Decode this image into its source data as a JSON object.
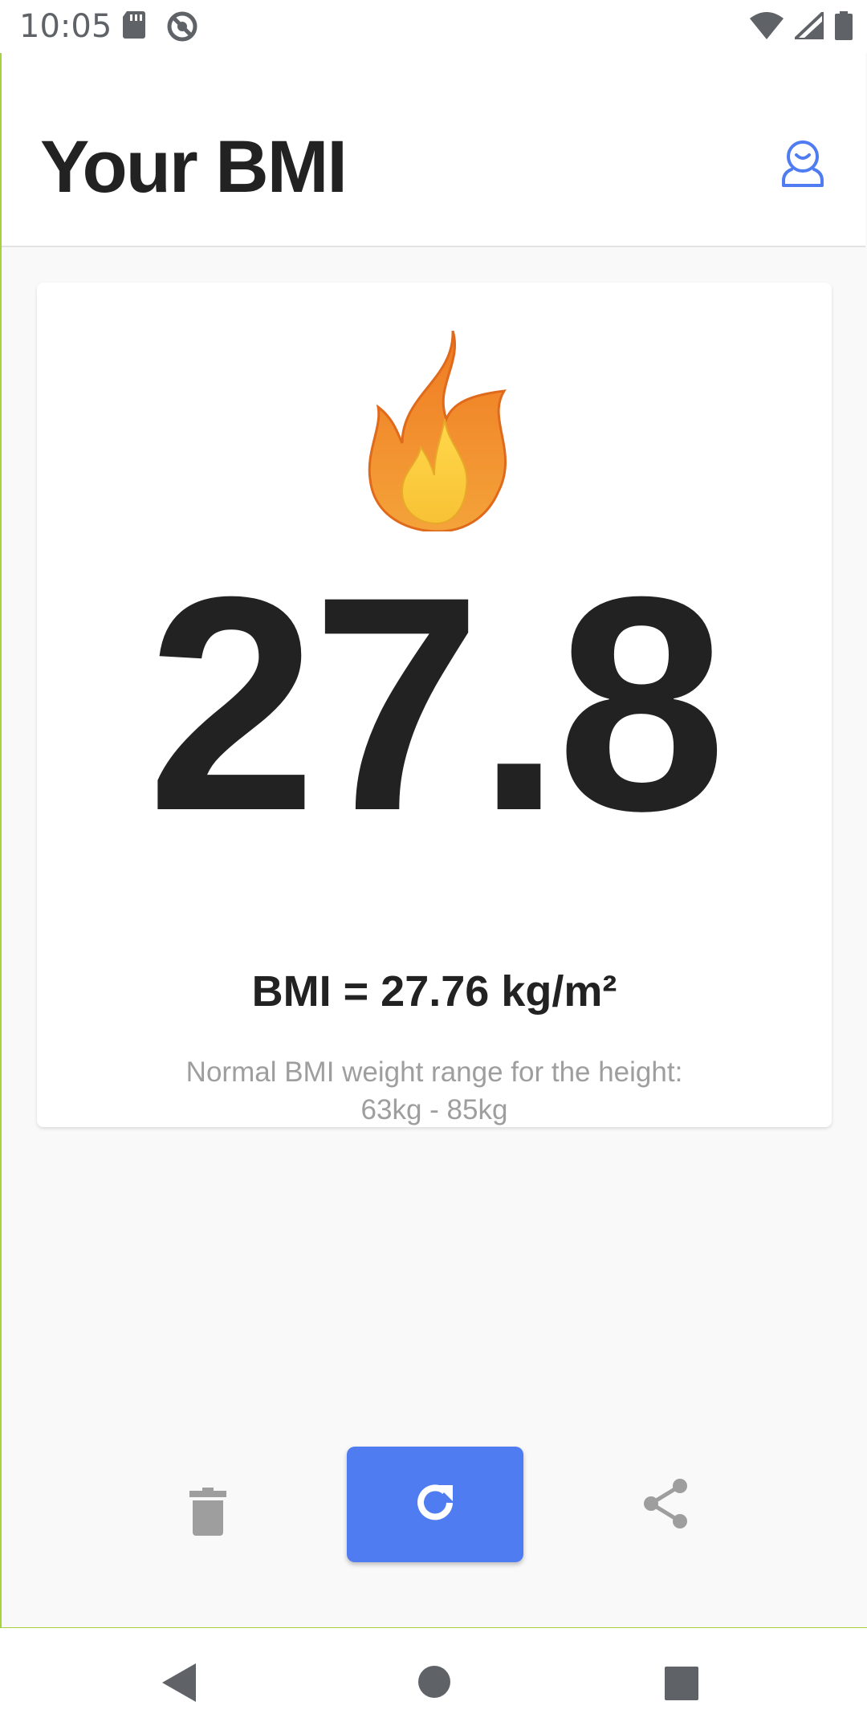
{
  "status_bar": {
    "time": "10:05",
    "left_icons": [
      "sd-card-icon",
      "do-not-disturb-icon"
    ],
    "right_icons": [
      "wifi-icon",
      "cell-signal-icon",
      "battery-icon"
    ]
  },
  "header": {
    "title": "Your BMI",
    "profile_icon": "profile-icon",
    "accent_color": "#4f7cf0"
  },
  "result": {
    "icon": "flame-icon",
    "bmi_value": "27.8",
    "formula": "BMI = 27.76 kg/m²",
    "range_label": "Normal BMI weight range for the height:",
    "range_value": "63kg - 85kg"
  },
  "actions": {
    "delete_icon": "trash-icon",
    "recalculate_icon": "refresh-icon",
    "share_icon": "share-icon",
    "primary_color": "#4f7cf0"
  },
  "nav_bar": {
    "icons": [
      "back-icon",
      "home-icon",
      "recents-icon"
    ]
  }
}
